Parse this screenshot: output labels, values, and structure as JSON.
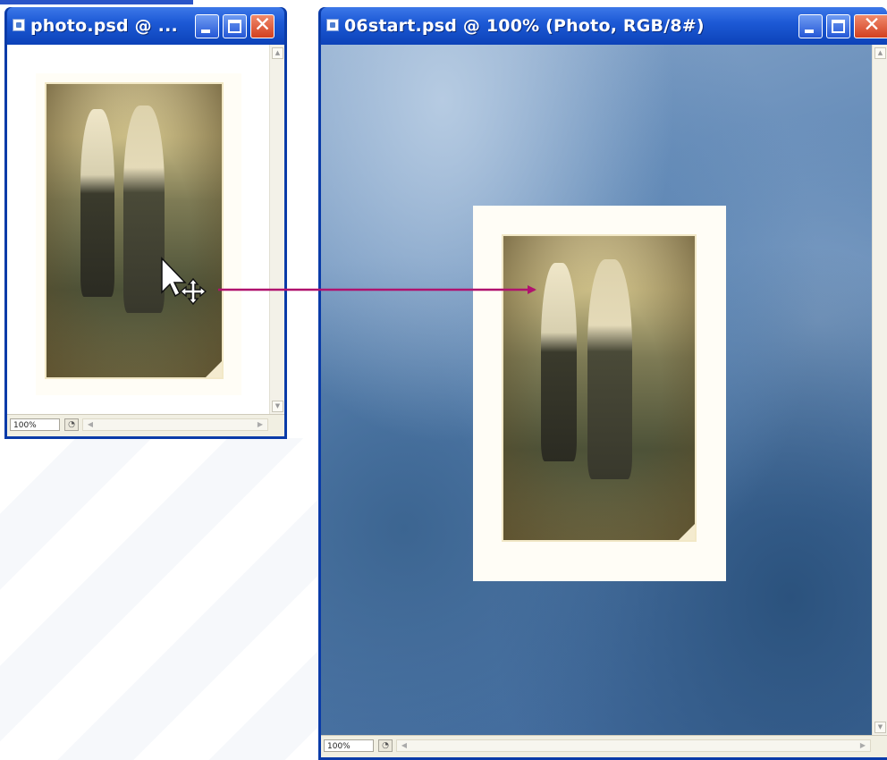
{
  "windows": {
    "left": {
      "title": "photo.psd @ ...",
      "zoom": "100%",
      "controls": {
        "minimize": "minimize-icon",
        "maximize": "maximize-icon",
        "close": "close-icon"
      }
    },
    "right": {
      "title": "06start.psd @  100% (Photo, RGB/8#)",
      "zoom": "100%",
      "controls": {
        "minimize": "minimize-icon",
        "maximize": "maximize-icon",
        "close": "close-icon"
      }
    }
  },
  "glyphs": {
    "close": "✕",
    "left_arrow": "◀",
    "right_arrow": "▶",
    "up_arrow": "▲",
    "down_arrow": "▼",
    "info": "◔"
  },
  "cursor": {
    "icon": "move-cursor-icon"
  },
  "drag_arrow": {
    "color": "#b0126e",
    "icon": "drag-arrow-icon"
  },
  "colors": {
    "titlebar": "#1d5ad6",
    "close_button": "#d2401f",
    "canvas_background": "#5a83b2"
  }
}
